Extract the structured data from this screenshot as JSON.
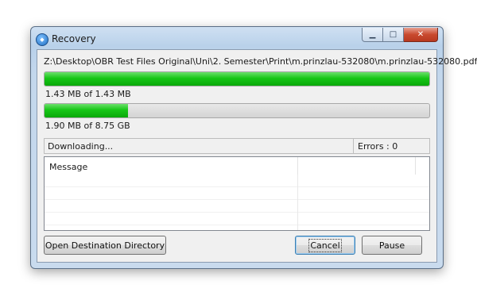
{
  "window": {
    "title": "Recovery",
    "icon": "app-logo-icon",
    "controls": {
      "minimize": "minimize-icon",
      "maximize": "maximize-icon",
      "close": "close-icon"
    }
  },
  "current_file": {
    "path": "Z:\\Desktop\\OBR Test Files Original\\Uni\\2. Semester\\Print\\m.prinzlau-532080\\m.prinzlau-532080.pdf",
    "progress_percent": 100,
    "size_text": "1.43 MB of 1.43 MB"
  },
  "overall": {
    "progress_percent": 21.7,
    "size_text": "1.90 MB of 8.75 GB"
  },
  "status": {
    "text": "Downloading...",
    "errors": "Errors : 0"
  },
  "message_list": {
    "columns": [
      "Message",
      "",
      ""
    ],
    "rows": []
  },
  "buttons": {
    "open_destination": "Open Destination Directory",
    "cancel": "Cancel",
    "pause": "Pause"
  },
  "colors": {
    "progress_fill": "#16c616",
    "close_button": "#c94a2f"
  }
}
